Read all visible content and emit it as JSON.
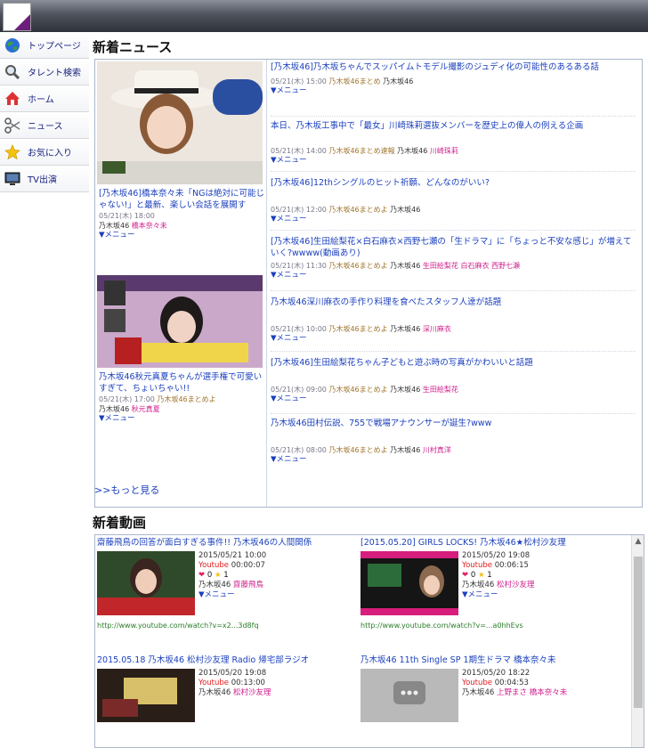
{
  "sidebar": {
    "items": [
      {
        "label": "トップページ",
        "icon": "globe-icon"
      },
      {
        "label": "タレント検索",
        "icon": "magnifier-icon"
      },
      {
        "label": "ホーム",
        "icon": "house-icon"
      },
      {
        "label": "ニュース",
        "icon": "scissors-icon"
      },
      {
        "label": "お気に入り",
        "icon": "star-icon"
      },
      {
        "label": "TV出演",
        "icon": "monitor-icon"
      }
    ]
  },
  "news": {
    "heading": "新着ニュース",
    "more_label": ">>もっと見る",
    "left": [
      {
        "title": "[乃木坂46]橋本奈々未「NGは絶対に可能じゃない!」と最新、楽しい会話を展開す",
        "meta": "05/21(木) 18:00",
        "tags": [
          "乃木坂46",
          "橋本奈々未"
        ],
        "menu": "▼メニュー"
      },
      {
        "title": "乃木坂46秋元真夏ちゃんが選手権で可愛いすぎて、ちょいちゃい!!",
        "meta": "05/21(木) 17:00",
        "source": "乃木坂46まとめよ",
        "tags": [
          "乃木坂46",
          "秋元真夏"
        ],
        "menu": "▼メニュー"
      }
    ],
    "right": [
      {
        "title": "[乃木坂46]乃木坂ちゃんでスッパイムトモデル撮影のジュディ化の可能性のあるある話",
        "meta": "05/21(木) 15:00",
        "source": "乃木坂46まとめ",
        "tags": [
          "乃木坂46"
        ],
        "menu": "▼メニュー"
      },
      {
        "title": "本日、乃木坂工事中で「最女」川崎珠莉選抜メンバーを歴史上の偉人の例える企画",
        "meta": "05/21(木) 14:00",
        "source": "乃木坂46まとめ速報",
        "tags": [
          "乃木坂46",
          "川崎珠莉"
        ],
        "menu": "▼メニュー"
      },
      {
        "title": "[乃木坂46]12thシングルのヒット祈願、どんなのがいい?",
        "meta": "05/21(木) 12:00",
        "source": "乃木坂46まとめよ",
        "tags": [
          "乃木坂46"
        ],
        "menu": "▼メニュー"
      },
      {
        "title": "[乃木坂46]生田絵梨花×白石麻衣×西野七瀬の「生ドラマ」に「ちょっと不安な感じ」が増えていく?wwww(動画あり)",
        "meta": "05/21(木) 11:30",
        "source": "乃木坂46まとめよ",
        "tags": [
          "乃木坂46",
          "生田絵梨花",
          "白石麻衣",
          "西野七瀬"
        ],
        "menu": "▼メニュー"
      },
      {
        "title": "乃木坂46深川麻衣の手作り料理を食べたスタッフ人達が話題",
        "meta": "05/21(木) 10:00",
        "source": "乃木坂46まとめよ",
        "tags": [
          "乃木坂46",
          "深川麻衣"
        ],
        "menu": "▼メニュー"
      },
      {
        "title": "[乃木坂46]生田絵梨花ちゃん子どもと遊ぶ時の写真がかわいいと話題",
        "meta": "05/21(木) 09:00",
        "source": "乃木坂46まとめよ",
        "tags": [
          "乃木坂46",
          "生田絵梨花"
        ],
        "menu": "▼メニュー"
      },
      {
        "title": "乃木坂46田村伝説、755で戦場アナウンサーが誕生?www",
        "meta": "05/21(木) 08:00",
        "source": "乃木坂46まとめよ",
        "tags": [
          "乃木坂46",
          "川村真洋"
        ],
        "menu": "▼メニュー"
      }
    ]
  },
  "videos": {
    "heading": "新着動画",
    "items": [
      {
        "title": "齋藤飛鳥の回答が面白すぎる事件!! 乃木坂46の人間関係",
        "date": "2015/05/21 10:00",
        "source": "Youtube",
        "duration": "00:00:07",
        "likes": "0",
        "stars": "1",
        "tags": [
          "乃木坂46",
          "齋藤飛鳥"
        ],
        "menu": "▼メニュー",
        "url": "http://www.youtube.com/watch?v=x2...3d8fq"
      },
      {
        "title": "[2015.05.20] GIRLS LOCKS! 乃木坂46★松村沙友理",
        "date": "2015/05/20 19:08",
        "source": "Youtube",
        "duration": "00:06:15",
        "likes": "0",
        "stars": "1",
        "tags": [
          "乃木坂46",
          "松村沙友理"
        ],
        "menu": "▼メニュー",
        "url": "http://www.youtube.com/watch?v=...a0hhEvs"
      },
      {
        "title": "2015.05.18 乃木坂46 松村沙友理 Radio 帰宅部ラジオ",
        "date": "2015/05/20 19:08",
        "source": "Youtube",
        "duration": "00:13:00",
        "tags": [
          "乃木坂46",
          "松村沙友理"
        ]
      },
      {
        "title": "乃木坂46 11th Single SP 1期生ドラマ 橋本奈々未",
        "date": "2015/05/20 18:22",
        "source": "Youtube",
        "duration": "00:04:53",
        "tags": [
          "乃木坂46",
          "上野まさ 橋本奈々未"
        ]
      }
    ]
  },
  "colors": {
    "link": "#1a3fbd",
    "tag_member": "#d0208e",
    "source_youtube": "#e02020",
    "url_green": "#2a7d2a",
    "brand_purple": "#6b1f7a"
  }
}
